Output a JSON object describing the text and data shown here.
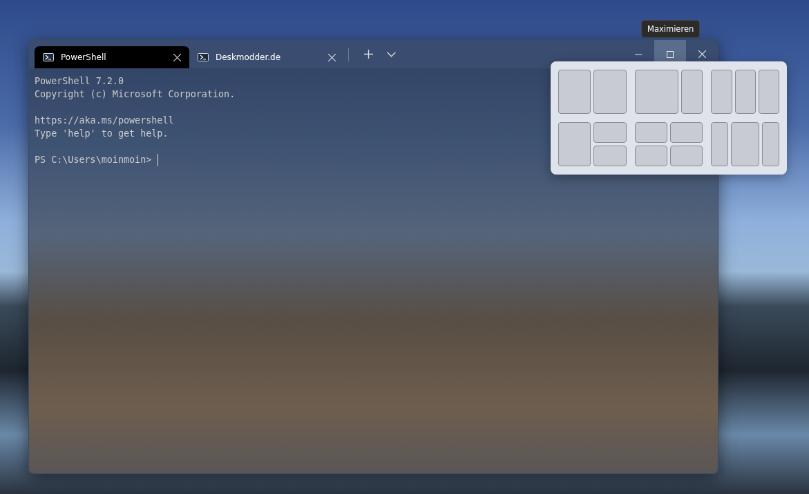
{
  "window": {
    "tabs": [
      {
        "title": "PowerShell",
        "selected": true
      },
      {
        "title": "Deskmodder.de",
        "selected": false
      }
    ],
    "caption_buttons": [
      {
        "kind": "minimize",
        "hovered": false
      },
      {
        "kind": "maximize",
        "hovered": true
      },
      {
        "kind": "close",
        "hovered": false
      }
    ],
    "tooltip": "Maximieren",
    "terminal": {
      "blocks": [
        [
          "PowerShell 7.2.0",
          "Copyright (c) Microsoft Corporation."
        ],
        [
          "https://aka.ms/powershell",
          "Type 'help' to get help."
        ]
      ],
      "prompt": "PS C:\\Users\\moinmoin>",
      "cursor": true
    }
  },
  "snap_layouts": [
    {
      "kind": "halves"
    },
    {
      "kind": "two-thirds-left"
    },
    {
      "kind": "thirds"
    },
    {
      "kind": "half-stacked"
    },
    {
      "kind": "quarters"
    },
    {
      "kind": "wide-center"
    }
  ]
}
